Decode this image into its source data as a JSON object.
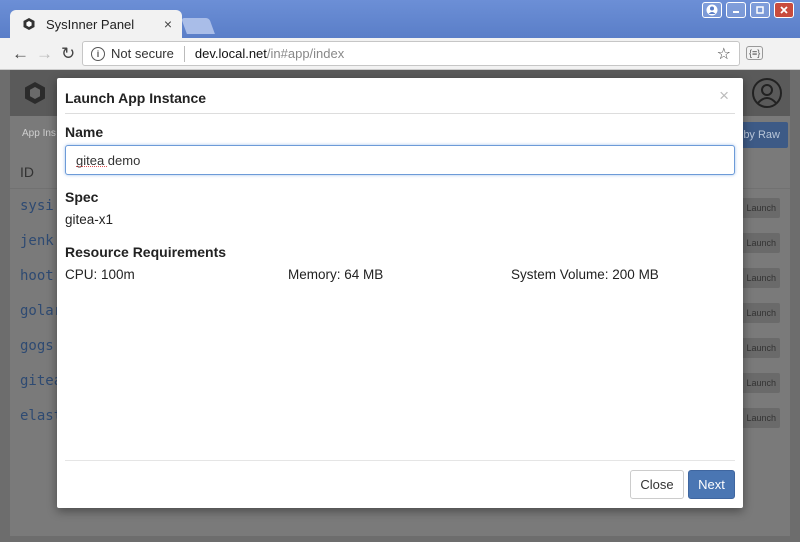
{
  "browser": {
    "tab_title": "SysInner Panel",
    "tab_close": "×",
    "security_label": "Not secure",
    "url_host": "dev.local.net",
    "url_path": "/in#app/index",
    "extension_label": "{≡}"
  },
  "background": {
    "breadcrumb": "App Ins",
    "raw_button": "by Raw",
    "column_id": "ID",
    "rows": [
      {
        "id": "sysi",
        "action": "Launch"
      },
      {
        "id": "jenk",
        "action": "Launch"
      },
      {
        "id": "hoot",
        "action": "Launch"
      },
      {
        "id": "golar",
        "action": "Launch"
      },
      {
        "id": "gogs",
        "action": "Launch"
      },
      {
        "id": "gitea",
        "action": "Launch"
      },
      {
        "id": "elast",
        "action": "Launch"
      }
    ]
  },
  "modal": {
    "title": "Launch App Instance",
    "close_x": "×",
    "name_label": "Name",
    "name_value": "gitea demo",
    "spec_label": "Spec",
    "spec_value": "gitea-x1",
    "resources_label": "Resource Requirements",
    "cpu": "CPU: 100m",
    "memory": "Memory: 64 MB",
    "volume": "System Volume: 200 MB",
    "close_button": "Close",
    "next_button": "Next"
  },
  "colors": {
    "primary": "#4a76b3",
    "titlebar": "#5a7ec8",
    "overlay": "#6d6d6d"
  }
}
